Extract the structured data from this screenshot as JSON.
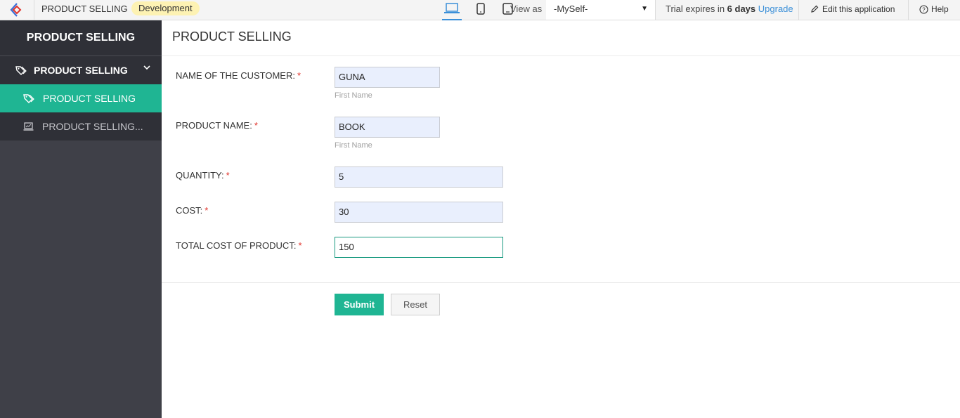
{
  "topbar": {
    "app_title": "PRODUCT SELLING",
    "environment_badge": "Development",
    "view_as_label": "View as",
    "view_as_value": "-MySelf-",
    "trial_prefix": "Trial expires in ",
    "trial_days": "6 days",
    "upgrade_link": "Upgrade",
    "edit_app_label": "Edit this application",
    "help_label": "Help",
    "icons": [
      "app-logo-icon",
      "laptop-icon",
      "phone-icon",
      "tablet-icon",
      "caret-down-icon",
      "pencil-icon",
      "help-circle-icon"
    ]
  },
  "sidebar": {
    "app_name": "PRODUCT SELLING",
    "section": {
      "label": "PRODUCT SELLING",
      "icon": "tag-icon",
      "expanded": true
    },
    "items": [
      {
        "label": "PRODUCT SELLING",
        "icon": "tag-icon",
        "active": true
      },
      {
        "label": "PRODUCT SELLING...",
        "icon": "report-icon",
        "active": false
      }
    ]
  },
  "form": {
    "title": "PRODUCT SELLING",
    "fields": [
      {
        "label": "NAME OF THE CUSTOMER:",
        "required": "*",
        "value": "GUNA",
        "hint": "First Name"
      },
      {
        "label": "PRODUCT NAME:",
        "required": "*",
        "value": "BOOK",
        "hint": "First Name"
      },
      {
        "label": "QUANTITY:",
        "required": "*",
        "value": "5"
      },
      {
        "label": "COST:",
        "required": "*",
        "value": "30"
      },
      {
        "label": "TOTAL COST OF PRODUCT:",
        "required": "*",
        "value": "150"
      }
    ],
    "submit_label": "Submit",
    "reset_label": "Reset"
  },
  "colors": {
    "accent_green": "#1fb593",
    "sidebar_bg": "#3f4048",
    "sidebar_dark": "#2f3037",
    "link_blue": "#3a8fd8",
    "badge_yellow": "#fdf2b3",
    "required_red": "#e0342c",
    "input_fill": "#e9effd"
  }
}
